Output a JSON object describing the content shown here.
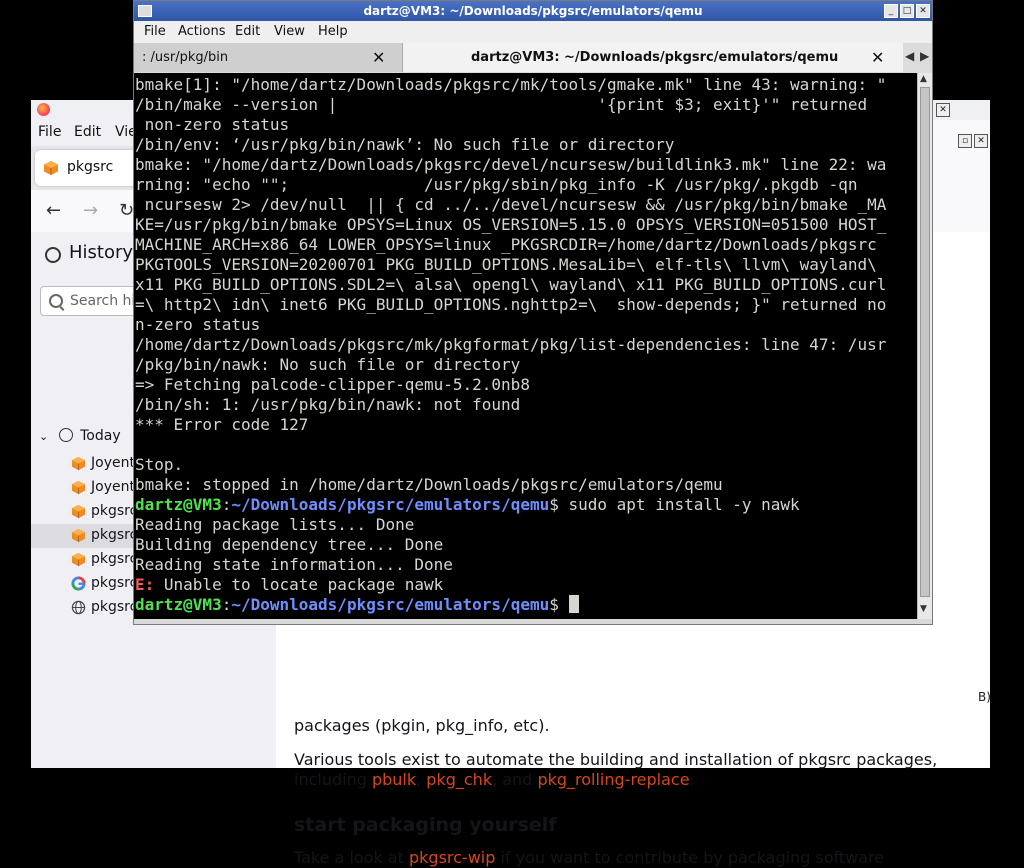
{
  "browser": {
    "menu": [
      "File",
      "Edit",
      "Vie"
    ],
    "tab_label": "pkgsrc",
    "sidebar_title": "History",
    "search_placeholder": "Search hi",
    "group_label": "Today",
    "items": [
      {
        "label": "Joyent",
        "icon": "pkgsrc-box-icon"
      },
      {
        "label": "Joyent",
        "icon": "pkgsrc-box-icon"
      },
      {
        "label": "pkgsrc",
        "icon": "pkgsrc-box-icon"
      },
      {
        "label": "pkgsrc",
        "icon": "pkgsrc-box-icon",
        "selected": true
      },
      {
        "label": "pkgsrc",
        "icon": "pkgsrc-box-icon"
      },
      {
        "label": "pkgsrc",
        "icon": "google-icon"
      },
      {
        "label": "pkgsrc",
        "icon": "globe-icon"
      }
    ],
    "content": {
      "partial_line": "packages (pkgin, pkg_info, etc).",
      "para1_start": "Various tools exist to automate the building and installation of pkgsrc packages,",
      "para1_including": "including ",
      "link_pbulk": "pbulk",
      "comma1": ", ",
      "link_pkg_chk": "pkg_chk",
      "and": ", and ",
      "link_rolling": "pkg_rolling-replace",
      "period": ".",
      "heading": "start packaging yourself",
      "para2_start": "Take a look at ",
      "link_wip": "pkgsrc-wip",
      "para2_end": " if you want to contribute by packaging software",
      "edge_text": "B)"
    },
    "accent_link": "#d5481d"
  },
  "terminal": {
    "title": "dartz@VM3: ~/Downloads/pkgsrc/emulators/qemu",
    "menu": [
      "File",
      "Actions",
      "Edit",
      "View",
      "Help"
    ],
    "tabs": [
      {
        "label": ": /usr/pkg/bin",
        "active": false
      },
      {
        "label": "dartz@VM3: ~/Downloads/pkgsrc/emulators/qemu",
        "active": true
      }
    ],
    "output": [
      "bmake[1]: \"/home/dartz/Downloads/pkgsrc/mk/tools/gmake.mk\" line 43: warning: \"",
      "/bin/make --version |                           '{print $3; exit}'\" returned",
      " non-zero status",
      "/bin/env: ‘/usr/pkg/bin/nawk’: No such file or directory",
      "bmake: \"/home/dartz/Downloads/pkgsrc/devel/ncursesw/buildlink3.mk\" line 22: wa",
      "rning: \"echo \"\";              /usr/pkg/sbin/pkg_info -K /usr/pkg/.pkgdb -qn",
      " ncursesw 2> /dev/null  || { cd ../../devel/ncursesw && /usr/pkg/bin/bmake _MA",
      "KE=/usr/pkg/bin/bmake OPSYS=Linux OS_VERSION=5.15.0 OPSYS_VERSION=051500 HOST_",
      "MACHINE_ARCH=x86_64 LOWER_OPSYS=linux _PKGSRCDIR=/home/dartz/Downloads/pkgsrc ",
      "PKGTOOLS_VERSION=20200701 PKG_BUILD_OPTIONS.MesaLib=\\ elf-tls\\ llvm\\ wayland\\ ",
      "x11 PKG_BUILD_OPTIONS.SDL2=\\ alsa\\ opengl\\ wayland\\ x11 PKG_BUILD_OPTIONS.curl",
      "=\\ http2\\ idn\\ inet6 PKG_BUILD_OPTIONS.nghttp2=\\  show-depends; }\" returned no",
      "n-zero status",
      "/home/dartz/Downloads/pkgsrc/mk/pkgformat/pkg/list-dependencies: line 47: /usr",
      "/pkg/bin/nawk: No such file or directory",
      "=> Fetching palcode-clipper-qemu-5.2.0nb8",
      "/bin/sh: 1: /usr/pkg/bin/nawk: not found",
      "*** Error code 127",
      "",
      "Stop.",
      "bmake: stopped in /home/dartz/Downloads/pkgsrc/emulators/qemu"
    ],
    "prompt_user": "dartz@VM3",
    "prompt_colon": ":",
    "prompt_path": "~/Downloads/pkgsrc/emulators/qemu",
    "prompt_dollar": "$ ",
    "command": "sudo apt install -y nawk",
    "apt_output": [
      "Reading package lists... Done",
      "Building dependency tree... Done",
      "Reading state information... Done"
    ],
    "error_prefix": "E:",
    "error_text": " Unable to locate package nawk",
    "colors": {
      "prompt_user": "#4ee34e",
      "prompt_path": "#6f8fff",
      "error": "#ef5a5a",
      "text": "#d3d7cf"
    }
  }
}
